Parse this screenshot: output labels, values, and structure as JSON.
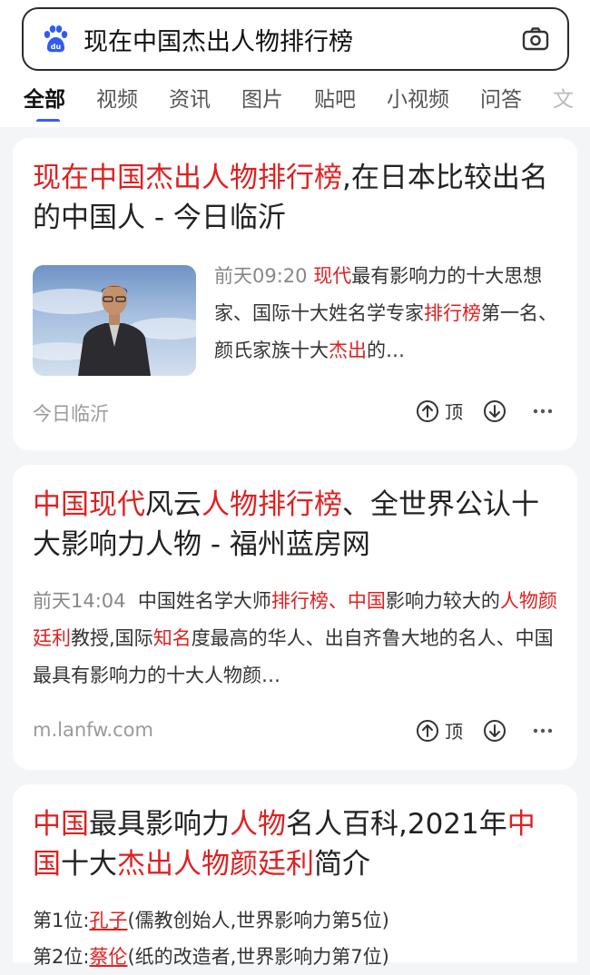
{
  "search": {
    "query": "现在中国杰出人物排行榜",
    "logo_icon": "baidu-paw-icon",
    "camera_icon": "camera-icon"
  },
  "tabs": [
    {
      "label": "全部",
      "active": true
    },
    {
      "label": "视频"
    },
    {
      "label": "资讯"
    },
    {
      "label": "图片"
    },
    {
      "label": "贴吧"
    },
    {
      "label": "小视频"
    },
    {
      "label": "问答"
    },
    {
      "label": "文"
    }
  ],
  "results": [
    {
      "title_parts": [
        {
          "text": "现在中国杰出人物排行榜",
          "hl": true
        },
        {
          "text": ",在日本比较出名的中国人 - 今日临沂",
          "hl": false
        }
      ],
      "time": "前天09:20",
      "snippet_parts": [
        {
          "text": "现代",
          "hl": true
        },
        {
          "text": "最有影响力的十大思想家、国际十大姓名学专家",
          "hl": false
        },
        {
          "text": "排行榜",
          "hl": true
        },
        {
          "text": "第一名、颜氏家族十大",
          "hl": false
        },
        {
          "text": "杰出",
          "hl": true
        },
        {
          "text": "的…",
          "hl": false
        }
      ],
      "source": "今日临沂",
      "top_label": "顶"
    },
    {
      "title_parts": [
        {
          "text": "中国现代",
          "hl": true
        },
        {
          "text": "风云",
          "hl": false
        },
        {
          "text": "人物排行榜",
          "hl": true
        },
        {
          "text": "、全世界公认十大影响力人物 - 福州蓝房网",
          "hl": false
        }
      ],
      "time": "前天14:04",
      "snippet_parts": [
        {
          "text": "中国姓名学大师",
          "hl": false
        },
        {
          "text": "排行榜",
          "hl": true
        },
        {
          "text": "、",
          "hl": false
        },
        {
          "text": "中国",
          "hl": true
        },
        {
          "text": "影响力较大的",
          "hl": false
        },
        {
          "text": "人物颜廷利",
          "hl": true
        },
        {
          "text": "教授,国际",
          "hl": false
        },
        {
          "text": "知名",
          "hl": true
        },
        {
          "text": "度最高的华人、出自齐鲁大地的名人、中国最具有影响力的十大人物颜…",
          "hl": false
        }
      ],
      "source": "m.lanfw.com",
      "top_label": "顶"
    },
    {
      "title_parts": [
        {
          "text": "中国",
          "hl": true
        },
        {
          "text": "最具影响力",
          "hl": false
        },
        {
          "text": "人物",
          "hl": true
        },
        {
          "text": "名人百科,2021年",
          "hl": false
        },
        {
          "text": "中国",
          "hl": true
        },
        {
          "text": "十大",
          "hl": false
        },
        {
          "text": "杰出人物颜廷利",
          "hl": true
        },
        {
          "text": "简介",
          "hl": false
        }
      ],
      "list": [
        {
          "prefix": "第1位:",
          "name": "孔子",
          "desc": "(儒教创始人,世界影响力第5位)"
        },
        {
          "prefix": "第2位:",
          "name": "蔡伦",
          "desc": "(纸的改造者,世界影响力第7位)"
        }
      ]
    }
  ],
  "colors": {
    "highlight": "#e02020",
    "tab_indicator": "#3a5bff",
    "baidu_blue": "#2f5cf0"
  }
}
